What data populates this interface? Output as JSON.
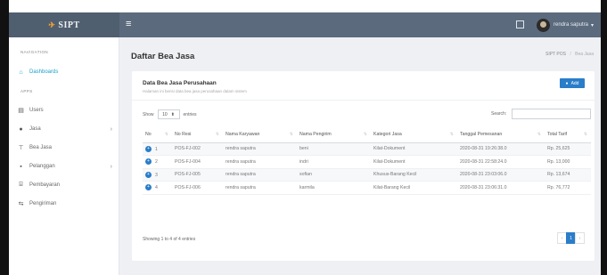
{
  "app": {
    "brand": "SIPT",
    "user_name": "rendra saputra"
  },
  "sidebar": {
    "section_navigation": "NAVIGATION",
    "section_apps": "APPS",
    "items": [
      {
        "label": "Dashboards",
        "icon": "home-icon",
        "active": true
      },
      {
        "label": "Users",
        "icon": "user-card-icon"
      },
      {
        "label": "Jasa",
        "icon": "users-icon",
        "has_submenu": true
      },
      {
        "label": "Bea Jasa",
        "icon": "cart-icon"
      },
      {
        "label": "Pelanggan",
        "icon": "notebook-icon",
        "has_submenu": true
      },
      {
        "label": "Pembayaran",
        "icon": "bank-icon"
      },
      {
        "label": "Pengiriman",
        "icon": "delivery-icon"
      }
    ]
  },
  "page": {
    "title": "Daftar Bea Jasa",
    "breadcrumb": [
      "SIPT POS",
      "Bea Jasa"
    ]
  },
  "card": {
    "title": "Data Bea Jasa Perusahaan",
    "subtitle": "Halaman ini berisi data bea jasa perusahaan dalam sistem",
    "add_label": "Add",
    "show_label": "Show",
    "page_length": "10",
    "entries_label": "entries",
    "search_label": "Search:",
    "search_value": ""
  },
  "table": {
    "columns": [
      "No",
      "No Resi",
      "Nama Karyawan",
      "Nama Pengirim",
      "Kategori Jasa",
      "Tanggal Pemesanan",
      "Total Tarif"
    ],
    "rows": [
      [
        "1",
        "POS-FJ-002",
        "rendra saputra",
        "beni",
        "Kilat-Dokument",
        "2020-08-31 19:26:38.0",
        "Rp. 25,625"
      ],
      [
        "2",
        "POS-FJ-004",
        "rendra saputra",
        "indri",
        "Kilat-Dokument",
        "2020-08-31 22:58:24.0",
        "Rp. 13,000"
      ],
      [
        "3",
        "POS-FJ-005",
        "rendra saputra",
        "sofian",
        "Khusus-Barang Kecil",
        "2020-08-31 23:03:06.0",
        "Rp. 13,674"
      ],
      [
        "4",
        "POS-FJ-006",
        "rendra saputra",
        "karmila",
        "Kilat-Barang Kecil",
        "2020-08-31 23:06:31.0",
        "Rp. 76,772"
      ]
    ]
  },
  "footer": {
    "info": "Showing 1 to 4 of 4 entries",
    "prev": "‹",
    "page": "1",
    "next": "›"
  },
  "colors": {
    "topbar": "#5b6b7d",
    "accent": "#2a7dc9",
    "active_nav": "#1aa0c7"
  }
}
